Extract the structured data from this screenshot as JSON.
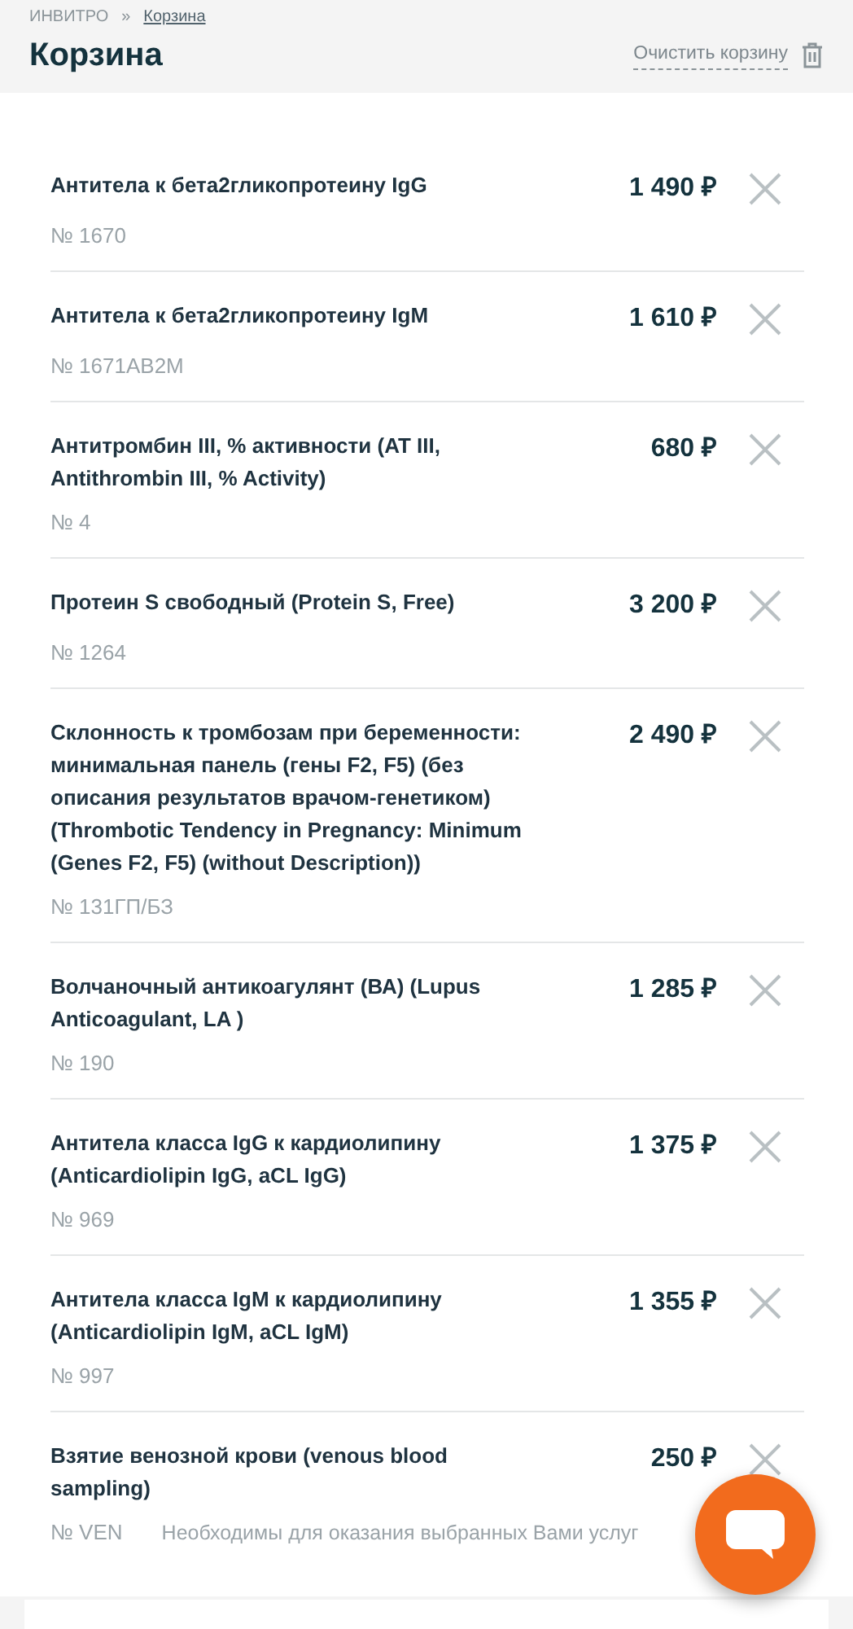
{
  "breadcrumbs": [
    {
      "label": "ИНВИТРО"
    },
    {
      "label": "Корзина"
    }
  ],
  "breadcrumb_separator": "»",
  "title": "Корзина",
  "clear_cart": {
    "label": "Очистить корзину"
  },
  "items": [
    {
      "name": "Антитела к бета2гликопротеину IgG",
      "code": "№ 1670",
      "price": "1 490 ₽"
    },
    {
      "name": "Антитела к бета2гликопротеину IgM",
      "code": "№ 1671AB2M",
      "price": "1 610 ₽"
    },
    {
      "name": "Антитромбин III, % активности (AT III, Antithrombin III, % Activity)",
      "code": "№ 4",
      "price": "680 ₽"
    },
    {
      "name": "Протеин S свободный (Protein S, Free)",
      "code": "№ 1264",
      "price": "3 200 ₽"
    },
    {
      "name": "Склонность к тромбозам при беременности: минимальная панель (гены F2, F5) (без описания результатов врачом-генетиком) (Thrombotic Tendency in Pregnancy: Minimum (Genes F2, F5) (without Description))",
      "code": "№ 131ГП/БЗ",
      "price": "2 490 ₽"
    },
    {
      "name": "Волчаночный антикоагулянт (ВА) (Lupus Anticoagulant, LA )",
      "code": "№ 190",
      "price": "1 285 ₽"
    },
    {
      "name": "Антитела класса IgG к кардиолипину (Anticardiolipin IgG, aCL IgG)",
      "code": "№ 969",
      "price": "1 375 ₽"
    },
    {
      "name": "Антитела класса IgM к кардиолипину (Anticardiolipin IgM, aCL IgM)",
      "code": "№ 997",
      "price": "1 355 ₽"
    },
    {
      "name": "Взятие венозной крови (venous blood sampling)",
      "code": "№ VEN",
      "price": "250 ₽",
      "note": "Необходимы для оказания выбранных Вами услуг"
    }
  ]
}
